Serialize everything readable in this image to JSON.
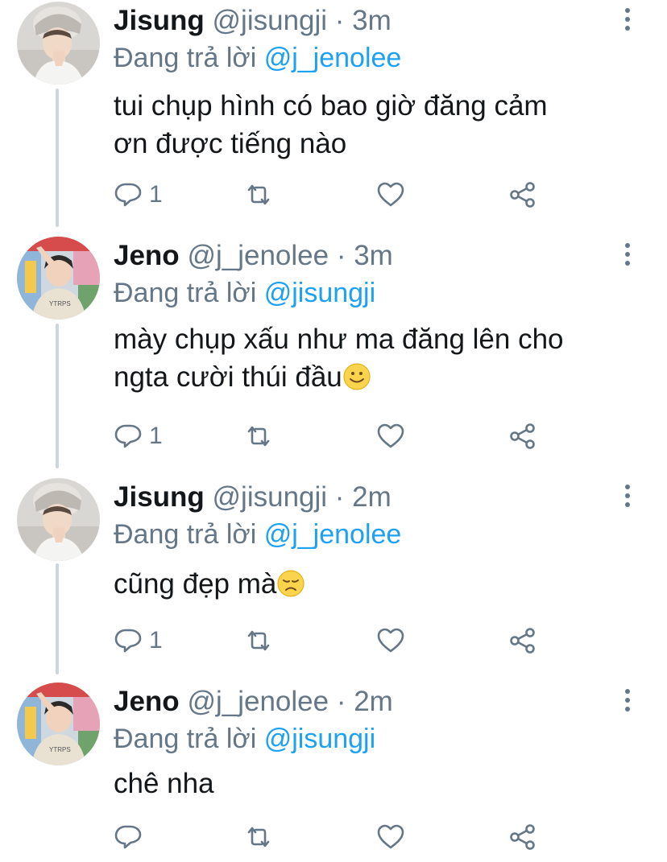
{
  "thread": {
    "tweets": [
      {
        "name": "Jisung",
        "handle": "@jisungji",
        "time": "3m",
        "reply_prefix": "Đang trả lời ",
        "reply_to": "@j_jenolee",
        "text_lines": [
          "tui chụp hình có bao giờ đăng cảm",
          "ơn được tiếng nào"
        ],
        "emoji": "",
        "reply_count": "1",
        "avatar": "jisung-avatar"
      },
      {
        "name": "Jeno",
        "handle": "@j_jenolee",
        "time": "3m",
        "reply_prefix": "Đang trả lời ",
        "reply_to": "@jisungji",
        "text_lines": [
          "mày chụp xấu như ma đăng lên cho",
          "ngta cười thúi đầu"
        ],
        "emoji": "slightly-smiling-face",
        "reply_count": "1",
        "avatar": "jeno-avatar"
      },
      {
        "name": "Jisung",
        "handle": "@jisungji",
        "time": "2m",
        "reply_prefix": "Đang trả lời ",
        "reply_to": "@j_jenolee",
        "text_lines": [
          "cũng đẹp mà"
        ],
        "emoji": "disappointed-face",
        "reply_count": "1",
        "avatar": "jisung-avatar"
      },
      {
        "name": "Jeno",
        "handle": "@j_jenolee",
        "time": "2m",
        "reply_prefix": "Đang trả lời ",
        "reply_to": "@jisungji",
        "text_lines": [
          "chê nha"
        ],
        "emoji": "",
        "reply_count": "",
        "avatar": "jeno-avatar"
      }
    ]
  },
  "separator": " · ",
  "icons": {
    "reply": "reply-bubble-icon",
    "retweet": "retweet-icon",
    "like": "heart-icon",
    "share": "share-icon",
    "more": "more-vertical-icon"
  },
  "colors": {
    "text": "#14171a",
    "secondary": "#657786",
    "link": "#1da1f2",
    "thread_line": "#ccd6dd"
  }
}
